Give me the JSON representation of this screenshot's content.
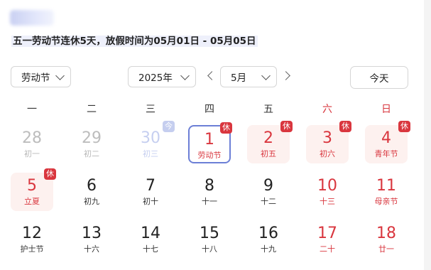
{
  "notice": "五一劳动节连休5天，放假时间为05月01日 - 05月05日",
  "controls": {
    "holiday_select": "劳动节",
    "year_select": "2025年",
    "month_select": "5月",
    "today_button": "今天",
    "prev_icon": "chevron-left-icon",
    "next_icon": "chevron-right-icon"
  },
  "weekdays": [
    "一",
    "二",
    "三",
    "四",
    "五",
    "六",
    "日"
  ],
  "rows": [
    [
      {
        "num": "28",
        "lunar": "初一",
        "style": "dim"
      },
      {
        "num": "29",
        "lunar": "初二",
        "style": "dim"
      },
      {
        "num": "30",
        "lunar": "初三",
        "style": "dimblue",
        "badge": "今",
        "badge_style": "blue"
      },
      {
        "num": "1",
        "lunar": "劳动节",
        "style": "red",
        "badge": "休",
        "selected": true
      },
      {
        "num": "2",
        "lunar": "初五",
        "style": "red",
        "badge": "休",
        "holiday": true
      },
      {
        "num": "3",
        "lunar": "初六",
        "style": "red",
        "badge": "休",
        "holiday": true
      },
      {
        "num": "4",
        "lunar": "青年节",
        "style": "red",
        "badge": "休",
        "holiday": true
      }
    ],
    [
      {
        "num": "5",
        "lunar": "立夏",
        "style": "red",
        "badge": "休",
        "holiday": true
      },
      {
        "num": "6",
        "lunar": "初九",
        "style": ""
      },
      {
        "num": "7",
        "lunar": "初十",
        "style": ""
      },
      {
        "num": "8",
        "lunar": "十一",
        "style": ""
      },
      {
        "num": "9",
        "lunar": "十二",
        "style": ""
      },
      {
        "num": "10",
        "lunar": "十三",
        "style": "red"
      },
      {
        "num": "11",
        "lunar": "母亲节",
        "style": "red"
      }
    ],
    [
      {
        "num": "12",
        "lunar": "护士节",
        "style": ""
      },
      {
        "num": "13",
        "lunar": "十六",
        "style": ""
      },
      {
        "num": "14",
        "lunar": "十七",
        "style": ""
      },
      {
        "num": "15",
        "lunar": "十八",
        "style": ""
      },
      {
        "num": "16",
        "lunar": "十九",
        "style": ""
      },
      {
        "num": "17",
        "lunar": "二十",
        "style": "red"
      },
      {
        "num": "18",
        "lunar": "廿一",
        "style": "red"
      }
    ]
  ]
}
